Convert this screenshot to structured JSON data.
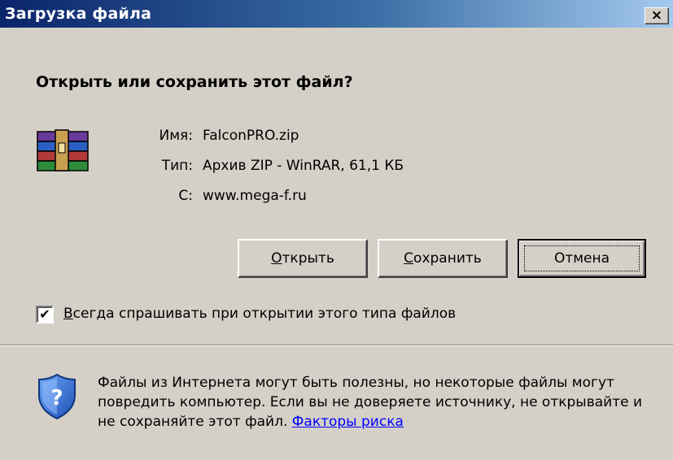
{
  "window": {
    "title": "Загрузка файла",
    "close_symbol": "×"
  },
  "dialog": {
    "heading": "Открыть или сохранить этот файл?",
    "file_icon": "winrar-archive-icon",
    "fields": [
      {
        "label": "Имя:",
        "value": "FalconPRO.zip"
      },
      {
        "label": "Тип:",
        "value": "Архив ZIP - WinRAR, 61,1 КБ"
      },
      {
        "label": "С:",
        "value": "www.mega-f.ru"
      }
    ],
    "buttons": {
      "open": "Открыть",
      "save": "Сохранить",
      "cancel": "Отмена"
    },
    "checkbox": {
      "checked": true,
      "mark": "✔",
      "label": "Всегда спрашивать при открытии этого типа файлов"
    },
    "warning": {
      "icon": "security-shield-icon",
      "text": "Файлы из Интернета могут быть полезны, но некоторые файлы могут повредить компьютер. Если вы не доверяете источнику, не открывайте и не сохраняйте этот файл. ",
      "link": "Факторы риска"
    }
  },
  "colors": {
    "titlebar_start": "#0a246a",
    "titlebar_end": "#a6caf0",
    "face": "#d4d0c8",
    "link": "#0000ff"
  }
}
